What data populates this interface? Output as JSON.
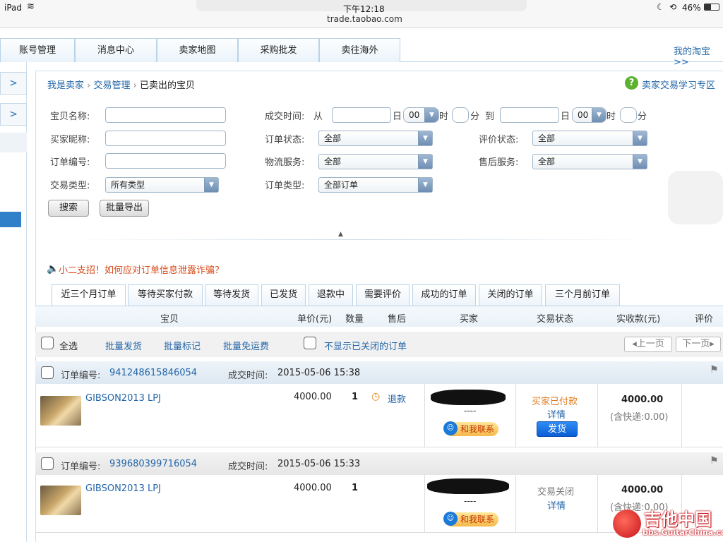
{
  "status": {
    "device": "iPad",
    "time": "下午12:18",
    "battery": "46%",
    "url": "trade.taobao.com"
  },
  "nav": {
    "tabs": [
      "账号管理",
      "消息中心",
      "卖家地图",
      "采购批发",
      "卖往海外"
    ],
    "my_taobao": "我的淘宝 >>"
  },
  "left": {
    "arrow": ">"
  },
  "breadcrumb": {
    "seller": "我是卖家",
    "trade": "交易管理",
    "sep": "›",
    "current": "已卖出的宝贝",
    "help": "卖家交易学习专区"
  },
  "filters": {
    "item_name": "宝贝名称:",
    "buyer_nick": "买家昵称:",
    "order_no": "订单编号:",
    "trade_type": "交易类型:",
    "trade_type_value": "所有类型",
    "deal_time": "成交时间:",
    "from": "从",
    "to": "到",
    "day": "日",
    "hour": "时",
    "minute": "分",
    "hour_value": "00",
    "order_status": "订单状态:",
    "order_status_value": "全部",
    "logistics": "物流服务:",
    "logistics_value": "全部",
    "order_type": "订单类型:",
    "order_type_value": "全部订单",
    "review_status": "评价状态:",
    "review_status_value": "全部",
    "after_sale": "售后服务:",
    "after_sale_value": "全部",
    "search": "搜索",
    "export": "批量导出"
  },
  "notice": {
    "text": "小二支招！如何应对订单信息泄露诈骗？"
  },
  "tabs": [
    "近三个月订单",
    "等待买家付款",
    "等待发货",
    "已发货",
    "退款中",
    "需要评价",
    "成功的订单",
    "关闭的订单",
    "三个月前订单"
  ],
  "columns": {
    "item": "宝贝",
    "price": "单价(元)",
    "qty": "数量",
    "after": "售后",
    "buyer": "买家",
    "status": "交易状态",
    "paid": "实收款(元)",
    "review": "评价"
  },
  "bulk": {
    "select_all": "全选",
    "ship": "批量发货",
    "mark": "批量标记",
    "free": "批量免运费",
    "hide_closed": "不显示已关闭的订单",
    "prev": "上一页",
    "next": "下一页"
  },
  "orders": [
    {
      "no_label": "订单编号:",
      "no": "941248615846054",
      "time_label": "成交时间:",
      "time": "2015-05-06 15:38",
      "item": "GIBSON2013 LPJ",
      "price": "4000.00",
      "qty": "1",
      "refund": "退款",
      "dash": "----",
      "contact": "和我联系",
      "status": "买家已付款",
      "detail": "详情",
      "ship": "发货",
      "amount": "4000.00",
      "shipping": "(含快递:0.00)"
    },
    {
      "no_label": "订单编号:",
      "no": "939680399716054",
      "time_label": "成交时间:",
      "time": "2015-05-06 15:33",
      "item": "GIBSON2013 LPJ",
      "price": "4000.00",
      "qty": "1",
      "dash": "----",
      "contact": "和我联系",
      "status": "交易关闭",
      "detail": "详情",
      "amount": "4000.00",
      "shipping": "(含快递:0.00)"
    }
  ],
  "watermark": {
    "title": "吉他中国",
    "url": "bbs.GuitarChina.com"
  }
}
